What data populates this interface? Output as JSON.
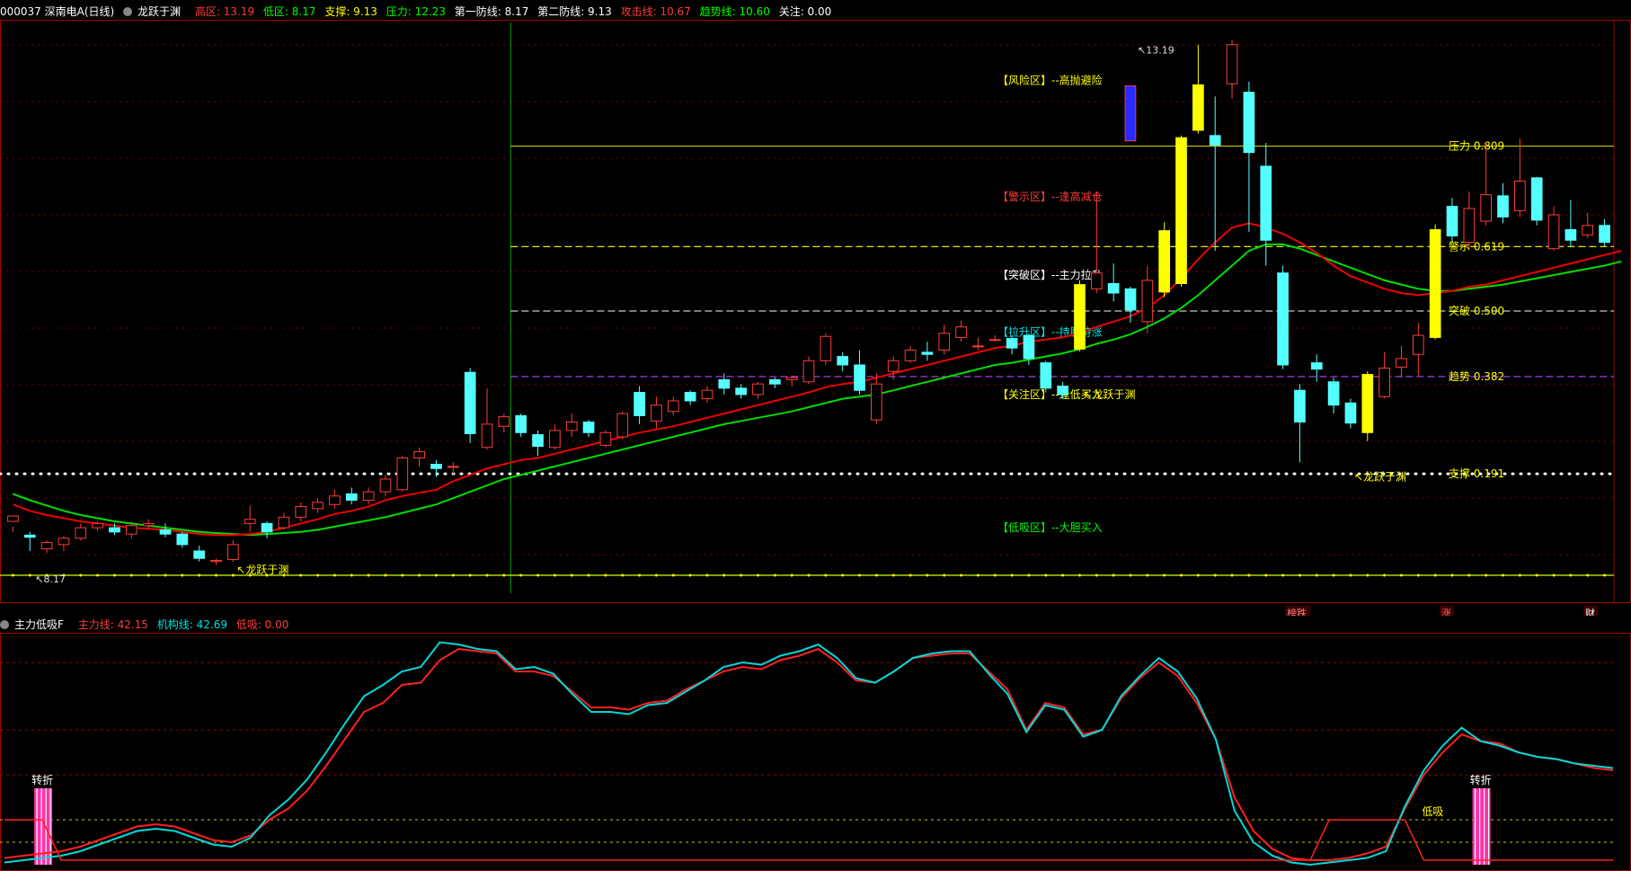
{
  "header": {
    "stock": "000037 深南电A(日线)",
    "indicator": "龙跃于渊",
    "items": [
      {
        "label": "高区: 13.19",
        "color": "#ff3b3b"
      },
      {
        "label": "低区: 8.17",
        "color": "#00ff00"
      },
      {
        "label": "支撑: 9.13",
        "color": "#ffff00"
      },
      {
        "label": "压力: 12.23",
        "color": "#00ff00"
      },
      {
        "label": "第一防线: 8.17",
        "color": "#ffffff"
      },
      {
        "label": "第二防线: 9.13",
        "color": "#ffffff"
      },
      {
        "label": "攻击线: 10.67",
        "color": "#ff3b3b"
      },
      {
        "label": "趋势线: 10.60",
        "color": "#00ff00"
      },
      {
        "label": "关注: 0.00",
        "color": "#ffffff"
      }
    ]
  },
  "sub_header": {
    "indicator": "主力低吸F",
    "items": [
      {
        "label": "主力线: 42.15",
        "color": "#ff3b3b"
      },
      {
        "label": "机构线: 42.69",
        "color": "#00e0e0"
      },
      {
        "label": "低吸: 0.00",
        "color": "#ff3b3b"
      }
    ]
  },
  "chart_data": [
    {
      "type": "candlestick",
      "title": "000037 深南电A(日线)",
      "ylim": [
        8.0,
        13.4
      ],
      "high_label": "13.19",
      "low_label": "8.17",
      "candles": [
        [
          8.68,
          8.73,
          8.58,
          8.63
        ],
        [
          8.55,
          8.53,
          8.4,
          8.58
        ],
        [
          8.42,
          8.48,
          8.38,
          8.5
        ],
        [
          8.46,
          8.52,
          8.4,
          8.54
        ],
        [
          8.52,
          8.62,
          8.5,
          8.66
        ],
        [
          8.62,
          8.66,
          8.59,
          8.68
        ],
        [
          8.62,
          8.58,
          8.55,
          8.66
        ],
        [
          8.56,
          8.64,
          8.52,
          8.68
        ],
        [
          8.64,
          8.66,
          8.6,
          8.7
        ],
        [
          8.6,
          8.56,
          8.53,
          8.66
        ],
        [
          8.56,
          8.46,
          8.43,
          8.58
        ],
        [
          8.4,
          8.33,
          8.3,
          8.45
        ],
        [
          8.3,
          8.31,
          8.27,
          8.33
        ],
        [
          8.32,
          8.46,
          8.3,
          8.5
        ],
        [
          8.66,
          8.7,
          8.58,
          8.83
        ],
        [
          8.66,
          8.58,
          8.52,
          8.68
        ],
        [
          8.62,
          8.72,
          8.6,
          8.76
        ],
        [
          8.72,
          8.82,
          8.68,
          8.86
        ],
        [
          8.8,
          8.86,
          8.76,
          8.9
        ],
        [
          8.84,
          8.92,
          8.8,
          8.98
        ],
        [
          8.94,
          8.88,
          8.84,
          9.0
        ],
        [
          8.88,
          8.96,
          8.84,
          9.0
        ],
        [
          8.96,
          9.08,
          8.92,
          9.12
        ],
        [
          8.98,
          9.28,
          8.96,
          9.3
        ],
        [
          9.28,
          9.34,
          9.2,
          9.38
        ],
        [
          9.22,
          9.18,
          9.1,
          9.26
        ],
        [
          9.2,
          9.2,
          9.12,
          9.24
        ],
        [
          10.09,
          9.51,
          9.42,
          10.13
        ],
        [
          9.38,
          9.6,
          9.36,
          9.94
        ],
        [
          9.58,
          9.67,
          9.52,
          9.7
        ],
        [
          9.68,
          9.52,
          9.48,
          9.7
        ],
        [
          9.5,
          9.39,
          9.3,
          9.54
        ],
        [
          9.38,
          9.54,
          9.36,
          9.6
        ],
        [
          9.54,
          9.62,
          9.48,
          9.7
        ],
        [
          9.62,
          9.52,
          9.48,
          9.64
        ],
        [
          9.4,
          9.52,
          9.38,
          9.54
        ],
        [
          9.48,
          9.7,
          9.46,
          9.72
        ],
        [
          9.9,
          9.68,
          9.6,
          9.96
        ],
        [
          9.63,
          9.78,
          9.56,
          9.86
        ],
        [
          9.72,
          9.82,
          9.68,
          9.86
        ],
        [
          9.9,
          9.82,
          9.78,
          9.92
        ],
        [
          9.84,
          9.92,
          9.8,
          9.96
        ],
        [
          10.02,
          9.94,
          9.88,
          10.08
        ],
        [
          9.94,
          9.88,
          9.84,
          9.98
        ],
        [
          9.88,
          9.98,
          9.84,
          10.0
        ],
        [
          10.02,
          9.98,
          9.94,
          10.04
        ],
        [
          10.02,
          10.04,
          9.96,
          10.06
        ],
        [
          10.0,
          10.2,
          9.98,
          10.24
        ],
        [
          10.2,
          10.43,
          10.16,
          10.46
        ],
        [
          10.24,
          10.16,
          10.1,
          10.28
        ],
        [
          10.16,
          9.92,
          9.88,
          10.3
        ],
        [
          9.64,
          9.98,
          9.6,
          10.08
        ],
        [
          10.1,
          10.2,
          10.02,
          10.24
        ],
        [
          10.2,
          10.3,
          10.18,
          10.34
        ],
        [
          10.28,
          10.26,
          10.2,
          10.38
        ],
        [
          10.3,
          10.46,
          10.26,
          10.54
        ],
        [
          10.42,
          10.52,
          10.38,
          10.58
        ],
        [
          10.34,
          10.34,
          10.3,
          10.42
        ],
        [
          10.4,
          10.4,
          10.38,
          10.44
        ],
        [
          10.41,
          10.32,
          10.26,
          10.44
        ],
        [
          10.44,
          10.22,
          10.16,
          10.46
        ],
        [
          10.18,
          9.94,
          9.9,
          10.2
        ],
        [
          9.96,
          9.88,
          9.84,
          10.0
        ],
        [
          10.31,
          10.92,
          10.29,
          10.96
        ],
        [
          10.88,
          11.03,
          10.84,
          11.8
        ],
        [
          10.93,
          10.84,
          10.76,
          11.12
        ],
        [
          10.88,
          10.68,
          10.56,
          10.9
        ],
        [
          10.57,
          10.96,
          10.46,
          11.1
        ],
        [
          10.85,
          11.43,
          10.8,
          11.51
        ],
        [
          10.93,
          12.31,
          10.9,
          12.33
        ],
        [
          12.38,
          12.81,
          12.35,
          13.19
        ],
        [
          12.33,
          12.24,
          11.24,
          12.7
        ],
        [
          12.82,
          13.19,
          12.68,
          13.23
        ],
        [
          12.74,
          12.17,
          11.42,
          12.84
        ],
        [
          12.04,
          11.34,
          11.1,
          12.26
        ],
        [
          11.03,
          10.16,
          10.12,
          11.1
        ],
        [
          9.92,
          9.62,
          9.24,
          9.98
        ],
        [
          10.18,
          10.12,
          10.0,
          10.26
        ],
        [
          10.0,
          9.78,
          9.7,
          10.04
        ],
        [
          9.8,
          9.61,
          9.56,
          9.84
        ],
        [
          9.52,
          10.07,
          9.44,
          10.1
        ],
        [
          9.86,
          10.13,
          9.84,
          10.28
        ],
        [
          10.14,
          10.22,
          10.04,
          10.34
        ],
        [
          10.26,
          10.44,
          10.06,
          10.56
        ],
        [
          10.42,
          11.44,
          10.4,
          11.49
        ],
        [
          11.66,
          11.38,
          11.32,
          11.74
        ],
        [
          11.32,
          11.64,
          11.26,
          11.8
        ],
        [
          11.52,
          11.77,
          11.48,
          12.27
        ],
        [
          11.76,
          11.56,
          11.5,
          11.88
        ],
        [
          11.62,
          11.9,
          11.56,
          12.3
        ],
        [
          11.93,
          11.53,
          11.48,
          11.94
        ],
        [
          11.26,
          11.58,
          11.24,
          11.66
        ],
        [
          11.44,
          11.34,
          11.28,
          11.72
        ],
        [
          11.39,
          11.48,
          11.36,
          11.6
        ],
        [
          11.48,
          11.32,
          11.28,
          11.54
        ]
      ],
      "ma_red": [
        8.84,
        8.78,
        8.74,
        8.71,
        8.68,
        8.66,
        8.64,
        8.62,
        8.61,
        8.6,
        8.58,
        8.56,
        8.55,
        8.55,
        8.56,
        8.58,
        8.62,
        8.66,
        8.7,
        8.75,
        8.78,
        8.82,
        8.88,
        8.92,
        8.95,
        8.98,
        9.06,
        9.12,
        9.18,
        9.22,
        9.26,
        9.28,
        9.32,
        9.36,
        9.4,
        9.44,
        9.48,
        9.52,
        9.55,
        9.58,
        9.62,
        9.66,
        9.7,
        9.74,
        9.78,
        9.82,
        9.86,
        9.9,
        9.95,
        9.98,
        10.0,
        10.04,
        10.08,
        10.12,
        10.16,
        10.2,
        10.24,
        10.28,
        10.32,
        10.34,
        10.38,
        10.4,
        10.42,
        10.46,
        10.52,
        10.57,
        10.62,
        10.7,
        10.82,
        10.98,
        11.16,
        11.32,
        11.46,
        11.5,
        11.46,
        11.4,
        11.32,
        11.22,
        11.1,
        11.0,
        10.94,
        10.88,
        10.84,
        10.82,
        10.84,
        10.86,
        10.9,
        10.92,
        10.96,
        11.0,
        11.04,
        11.08,
        11.12,
        11.16,
        11.2,
        11.24
      ],
      "ma_green": [
        8.94,
        8.88,
        8.83,
        8.78,
        8.74,
        8.71,
        8.68,
        8.66,
        8.64,
        8.62,
        8.6,
        8.58,
        8.57,
        8.56,
        8.55,
        8.56,
        8.57,
        8.58,
        8.6,
        8.63,
        8.66,
        8.69,
        8.72,
        8.76,
        8.8,
        8.84,
        8.9,
        8.96,
        9.02,
        9.08,
        9.12,
        9.16,
        9.2,
        9.24,
        9.28,
        9.32,
        9.36,
        9.4,
        9.44,
        9.48,
        9.52,
        9.56,
        9.6,
        9.63,
        9.66,
        9.69,
        9.72,
        9.76,
        9.8,
        9.84,
        9.86,
        9.88,
        9.92,
        9.96,
        10.0,
        10.04,
        10.08,
        10.12,
        10.16,
        10.18,
        10.21,
        10.24,
        10.27,
        10.31,
        10.36,
        10.4,
        10.45,
        10.52,
        10.6,
        10.7,
        10.82,
        10.96,
        11.1,
        11.24,
        11.3,
        11.3,
        11.26,
        11.2,
        11.14,
        11.08,
        11.02,
        10.96,
        10.92,
        10.88,
        10.86,
        10.86,
        10.88,
        10.9,
        10.92,
        10.95,
        10.98,
        11.01,
        11.04,
        11.07,
        11.1,
        11.14
      ],
      "hlines": [
        {
          "value": 12.23,
          "label": "压力 0.809",
          "color": "#c8c800",
          "dash": ""
        },
        {
          "value": 11.28,
          "label": "警示 0.619",
          "color": "#ffff00",
          "dash": "8 4"
        },
        {
          "value": 10.67,
          "label": "突破 0.500",
          "color": "#c8c8c8",
          "dash": "8 4"
        },
        {
          "value": 10.05,
          "label": "趋势 0.382",
          "color": "#c040ff",
          "dash": "8 4"
        },
        {
          "value": 9.13,
          "label": "支撑 0.191",
          "color": "#ffffff",
          "dash": "1 8"
        },
        {
          "value": 8.17,
          "label": "",
          "color": "#c8ff00",
          "dash": ""
        }
      ],
      "zones": [
        {
          "text": "【风险区】--高抛避险",
          "value": 12.85,
          "color": "#ffff00"
        },
        {
          "text": "【警示区】--逢高减仓",
          "value": 11.75,
          "color": "#ff3b3b"
        },
        {
          "text": "【突破区】--主力拉升",
          "value": 11.01,
          "color": "#ffffff"
        },
        {
          "text": "【拉升区】--持股待涨",
          "value": 10.47,
          "color": "#00e0e0"
        },
        {
          "text": "【关注区】--逢低买入",
          "value": 9.88,
          "color": "#ffff00"
        },
        {
          "text": "【低吸区】--大胆买入",
          "value": 8.62,
          "color": "#00ff00"
        }
      ],
      "annotations": [
        {
          "text": "龙跃于渊",
          "index": 13,
          "value": 8.22
        },
        {
          "text": "龙跃于渊",
          "index": 63,
          "value": 9.88
        },
        {
          "text": "龙跃于渊",
          "index": 79,
          "value": 9.1
        }
      ],
      "markers": [
        {
          "text": "榜跌",
          "color": "#ff8080"
        },
        {
          "text": "涨",
          "color": "#ff6060"
        },
        {
          "text": "财",
          "color": "#ffffff"
        }
      ]
    },
    {
      "type": "line",
      "title": "主力低吸F",
      "ylim": [
        0,
        100
      ],
      "levels": [
        90,
        60,
        40,
        20,
        10
      ],
      "signals": [
        {
          "text": "转折",
          "index": 2
        },
        {
          "text": "转折",
          "index": 78
        }
      ],
      "dixi_label": {
        "text": "低吸",
        "index": 75
      },
      "series": [
        {
          "name": "主力线",
          "color": "#ff2020",
          "values": [
            3,
            4,
            5,
            6,
            8,
            11,
            14,
            17,
            18,
            17,
            14,
            11,
            10,
            13,
            20,
            25,
            33,
            44,
            56,
            68,
            72,
            80,
            81,
            91,
            96,
            95,
            94,
            86,
            86,
            84,
            77,
            70,
            70,
            69,
            72,
            73,
            78,
            82,
            86,
            88,
            87,
            91,
            93,
            96,
            90,
            82,
            81,
            86,
            92,
            93,
            94,
            94,
            86,
            78,
            60,
            72,
            70,
            58,
            60,
            74,
            83,
            90,
            84,
            72,
            56,
            30,
            15,
            7,
            3,
            2,
            2,
            3,
            5,
            8,
            25,
            40,
            50,
            58,
            55,
            54,
            50,
            48,
            47,
            45,
            43,
            42
          ]
        },
        {
          "name": "机构线",
          "color": "#00d8d8",
          "values": [
            1,
            2,
            3,
            4,
            6,
            9,
            12,
            15,
            16,
            15,
            12,
            9,
            8,
            12,
            22,
            29,
            38,
            50,
            63,
            75,
            80,
            86,
            88,
            99,
            98,
            96,
            95,
            87,
            88,
            85,
            76,
            68,
            68,
            67,
            71,
            72,
            77,
            82,
            88,
            90,
            89,
            93,
            95,
            98,
            92,
            83,
            81,
            86,
            92,
            94,
            95,
            95,
            85,
            76,
            59,
            71,
            69,
            57,
            60,
            75,
            84,
            92,
            86,
            74,
            56,
            24,
            10,
            4,
            1,
            0,
            1,
            2,
            3,
            6,
            26,
            42,
            53,
            61,
            55,
            53,
            50,
            48,
            47,
            45,
            44,
            43
          ]
        },
        {
          "name": "低吸",
          "color": "#ff2020",
          "values": [
            20,
            20,
            20,
            2,
            2,
            2,
            2,
            2,
            2,
            2,
            2,
            2,
            2,
            2,
            2,
            2,
            2,
            2,
            2,
            2,
            2,
            2,
            2,
            2,
            2,
            2,
            2,
            2,
            2,
            2,
            2,
            2,
            2,
            2,
            2,
            2,
            2,
            2,
            2,
            2,
            2,
            2,
            2,
            2,
            2,
            2,
            2,
            2,
            2,
            2,
            2,
            2,
            2,
            2,
            2,
            2,
            2,
            2,
            2,
            2,
            2,
            2,
            2,
            2,
            2,
            2,
            2,
            2,
            2,
            2,
            20,
            20,
            20,
            20,
            20,
            2,
            2,
            2,
            2,
            2,
            2,
            2,
            2,
            2,
            2,
            2
          ]
        }
      ]
    }
  ]
}
